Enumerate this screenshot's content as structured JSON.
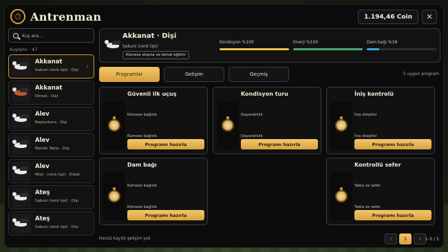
{
  "app": {
    "title": "Antrenman",
    "coin": "1.194,46 Coin",
    "close": "✕"
  },
  "sidebar": {
    "search_placeholder": "Kuş ara...",
    "count_label": "Kuşların · 47",
    "birds": [
      {
        "name": "Akkanat",
        "sub": "Sabuni (renk tipi) · Dişi"
      },
      {
        "name": "Akkanat",
        "sub": "Dönek · Dişi"
      },
      {
        "name": "Alev",
        "sub": "Baştankara · Dişi"
      },
      {
        "name": "Alev",
        "sub": "Mardin Takla · Dişi"
      },
      {
        "name": "Alev",
        "sub": "Misk · (renk tipi) · Erkek"
      },
      {
        "name": "Ateş",
        "sub": "Sabuni (renk tipi) · Dişi"
      },
      {
        "name": "Ateş",
        "sub": "Sabuni (renk tipi) · Dişi"
      }
    ]
  },
  "hero": {
    "name": "Akkanat · Dişi",
    "sub": "Sabuni (renk tipi)",
    "tag": "Kümese alışma ve temel eğitim",
    "stats": [
      {
        "label": "Kondisyon %100",
        "value": 100,
        "color": "#e8c24a"
      },
      {
        "label": "Enerji %100",
        "value": 100,
        "color": "#4ea874"
      },
      {
        "label": "Dam bağı %18",
        "value": 18,
        "color": "#3da6e0"
      }
    ]
  },
  "tabs": [
    "Programlar",
    "Gelişim",
    "Geçmiş"
  ],
  "tab_info": "5 uygun program",
  "programs": [
    {
      "title": "Güvenli ilk uçuş",
      "desc1": "Kümese bağlılık",
      "desc2": "Kümese bağlılık",
      "button": "Programı hazırla"
    },
    {
      "title": "Kondisyon turu",
      "desc1": "Dayanıklılık",
      "desc2": "Dayanıklılık",
      "button": "Programı hazırla"
    },
    {
      "title": "İniş kontrolü",
      "desc1": "İniş disiplini",
      "desc2": "İniş disiplini",
      "button": "Programı hazırla"
    },
    {
      "title": "Dam bağı",
      "desc1": "Kümese bağlılık",
      "desc2": "Kümese bağlılık",
      "button": "Programı hazırla"
    },
    {
      "title": "Kontrollü sefer",
      "desc1": "Takla ve sefer",
      "desc2": "Takla ve sefer",
      "button": "Programı hazırla"
    }
  ],
  "footer": {
    "note": "Henüz kayıtlı gelişim yok",
    "prev": "‹",
    "page": "1",
    "next": "›",
    "range": "1–5 / 5"
  }
}
